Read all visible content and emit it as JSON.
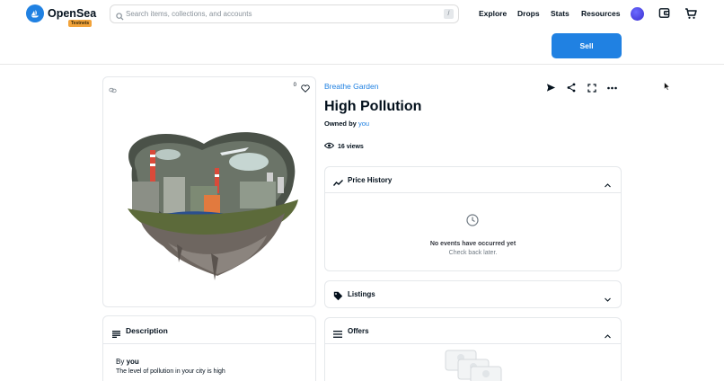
{
  "header": {
    "brand": "OpenSea",
    "badge": "Testnets",
    "search_placeholder": "Search items, collections, and accounts",
    "search_shortcut": "/",
    "nav": [
      "Explore",
      "Drops",
      "Stats",
      "Resources"
    ],
    "icons": [
      "wallet-icon",
      "cart-icon"
    ]
  },
  "sell_button": "Sell",
  "asset": {
    "likes": "0",
    "collection": "Breathe Garden",
    "title": "High Pollution",
    "owned_by_label": "Owned by",
    "owner": "you",
    "views": "16 views"
  },
  "panels": {
    "price_history": {
      "title": "Price History",
      "empty_title": "No events have occurred yet",
      "empty_sub": "Check back later."
    },
    "listings": {
      "title": "Listings"
    },
    "offers": {
      "title": "Offers"
    }
  },
  "description": {
    "title": "Description",
    "by_label": "By",
    "by_value": "you",
    "text": "The level of pollution in your city is high"
  },
  "colors": {
    "accent": "#2081e2",
    "badge": "#f2a33a",
    "text": "#04111d"
  }
}
